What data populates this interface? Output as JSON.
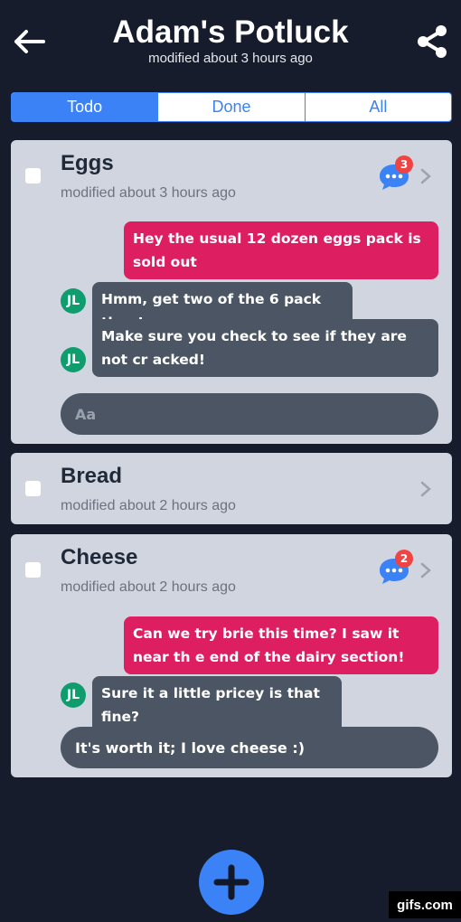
{
  "header": {
    "title": "Adam's Potluck",
    "subtitle": "modified about 3 hours ago"
  },
  "tabs": [
    {
      "label": "Todo",
      "active": true
    },
    {
      "label": "Done",
      "active": false
    },
    {
      "label": "All",
      "active": false
    }
  ],
  "items": [
    {
      "title": "Eggs",
      "modified": "modified about 3 hours ago",
      "unread_count": "3",
      "messages": [
        {
          "from": "me",
          "text": "Hey the usual 12 dozen eggs pack is sold out"
        },
        {
          "from": "JL",
          "text": "Hmm, get two of the 6 pack then!"
        },
        {
          "from": "JL",
          "text": "Make sure you check to see if they are not cr acked!"
        }
      ],
      "composer_placeholder": "Aa"
    },
    {
      "title": "Bread",
      "modified": "modified about 2 hours ago"
    },
    {
      "title": "Cheese",
      "modified": "modified about 2 hours ago",
      "unread_count": "2",
      "messages": [
        {
          "from": "me",
          "text": "Can we try brie this time? I saw it near th e end of the dairy section!"
        },
        {
          "from": "JL",
          "text": "Sure it a little pricey is that fine?"
        }
      ],
      "composer_value": "It's worth it; I love cheese :)"
    }
  ],
  "watermark": "gifs.com",
  "colors": {
    "background": "#161c2c",
    "accent": "#3b82f6",
    "outgoing": "#dd1f62",
    "incoming": "#4b5563",
    "avatar": "#0f9d6e",
    "badge": "#ef4444"
  },
  "icons": {
    "back": "arrow-left-icon",
    "share": "share-icon",
    "chat": "chat-bubble-icon",
    "chevron": "chevron-right-icon",
    "add": "plus-icon"
  }
}
